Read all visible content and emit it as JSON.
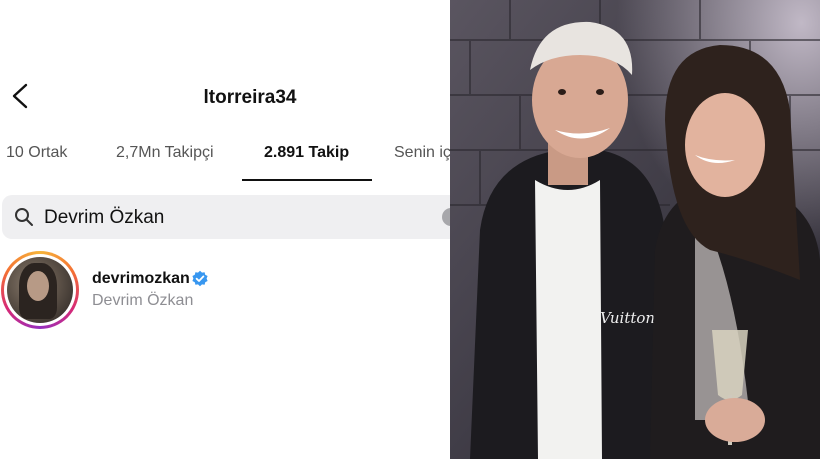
{
  "header": {
    "title": "ltorreira34"
  },
  "tabs": [
    {
      "label": "10 Ortak"
    },
    {
      "label": "2,7Mn Takipçi"
    },
    {
      "label": "2.891 Takip"
    },
    {
      "label": "Senin iç"
    }
  ],
  "search": {
    "value": "Devrim Özkan"
  },
  "result": {
    "username": "devrimozkan",
    "display_name": "Devrim Özkan"
  },
  "photo": {
    "jacket_text": "Vuitton"
  },
  "colors": {
    "verified": "#3897f0",
    "underline": "#111111",
    "search_bg": "#efeff1"
  }
}
